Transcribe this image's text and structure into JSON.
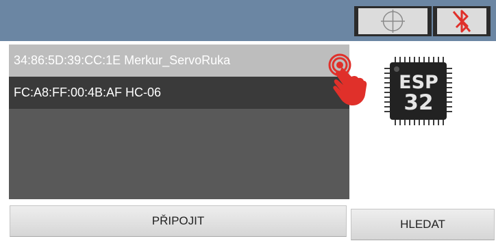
{
  "topbar": {
    "icons": {
      "left": "crosshair-icon",
      "right": "bluetooth-disabled-icon"
    },
    "colors": {
      "bar": "#6b86a3",
      "bluetooth_off": "#e0302a"
    }
  },
  "devices": [
    {
      "address": "34:86:5D:39:CC:1E",
      "name": "Merkur_ServoRuka",
      "label": "34:86:5D:39:CC:1E Merkur_ServoRuka",
      "selected": true
    },
    {
      "address": "FC:A8:FF:00:4B:AF",
      "name": "HC-06",
      "label": "FC:A8:FF:00:4B:AF HC-06",
      "selected": false
    }
  ],
  "chip": {
    "line1": "ESP",
    "line2": "32"
  },
  "buttons": {
    "connect": "PŘIPOJIT",
    "search": "HLEDAT"
  },
  "overlay": {
    "icon": "tap-hand-icon",
    "color": "#e0302a"
  }
}
